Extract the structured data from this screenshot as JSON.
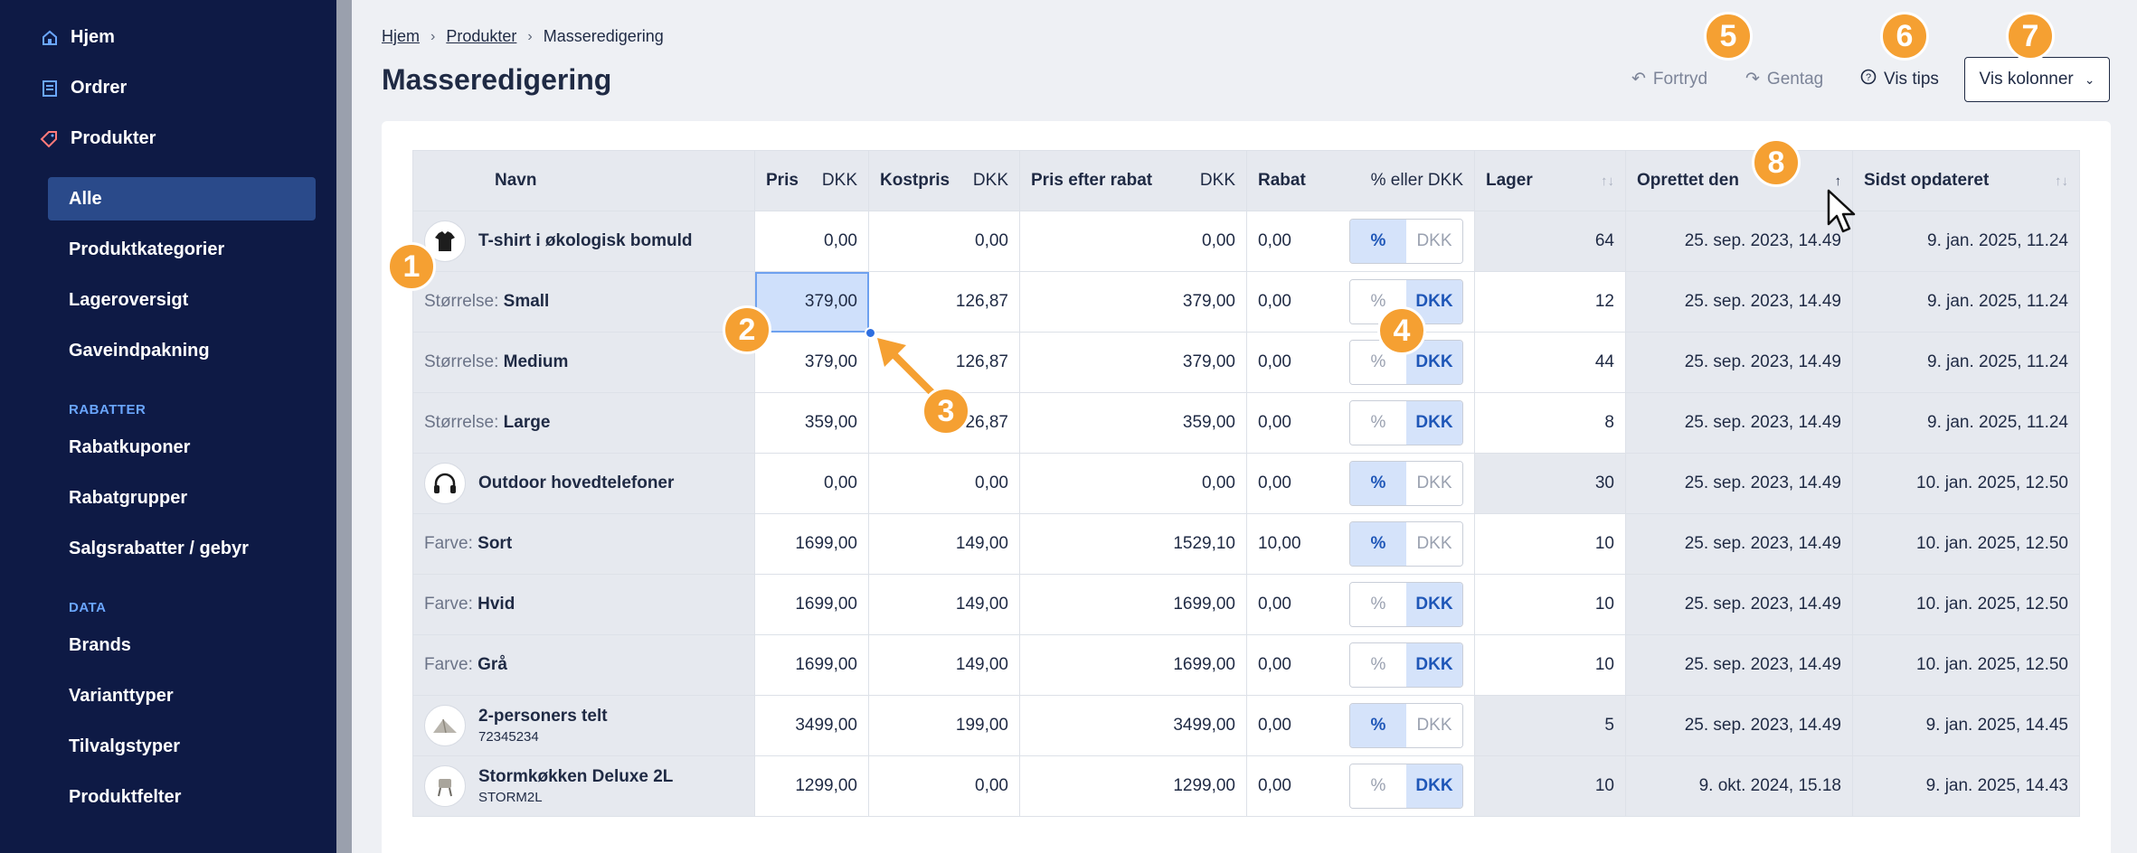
{
  "sidebar": {
    "top_items": [
      {
        "label": "Hjem",
        "icon": "home-icon"
      },
      {
        "label": "Ordrer",
        "icon": "orders-icon"
      },
      {
        "label": "Produkter",
        "icon": "tag-icon"
      }
    ],
    "product_items": [
      "Alle",
      "Produktkategorier",
      "Lageroversigt",
      "Gaveindpakning"
    ],
    "section_rabatter": "RABATTER",
    "rabatter_items": [
      "Rabatkuponer",
      "Rabatgrupper",
      "Salgsrabatter / gebyr"
    ],
    "section_data": "DATA",
    "data_items": [
      "Brands",
      "Varianttyper",
      "Tilvalgstyper",
      "Produktfelter"
    ]
  },
  "breadcrumb": [
    "Hjem",
    "Produkter",
    "Masseredigering"
  ],
  "page_title": "Masseredigering",
  "toolbar": {
    "undo": "Fortryd",
    "redo": "Gentag",
    "tips": "Vis tips",
    "columns": "Vis kolonner"
  },
  "table": {
    "headers": {
      "name": "Navn",
      "price": "Pris",
      "price_unit": "DKK",
      "cost": "Kostpris",
      "cost_unit": "DKK",
      "discounted": "Pris efter rabat",
      "discounted_unit": "DKK",
      "discount": "Rabat",
      "discount_unit": "% eller DKK",
      "stock": "Lager",
      "created": "Oprettet den",
      "updated": "Sidst opdateret"
    },
    "toggle_percent": "%",
    "toggle_dkk": "DKK",
    "rows": [
      {
        "kind": "product",
        "thumb": "tshirt-icon",
        "name": "T-shirt i økologisk bomuld",
        "sku": "",
        "price": "0,00",
        "cost": "0,00",
        "discounted": "0,00",
        "discount": "0,00",
        "mode": "percent",
        "stock": "64",
        "created": "25. sep. 2023, 14.49",
        "updated": "9. jan. 2025, 11.24"
      },
      {
        "kind": "variant",
        "vlabel": "Størrelse:",
        "vvalue": "Small",
        "price": "379,00",
        "cost": "126,87",
        "discounted": "379,00",
        "discount": "0,00",
        "mode": "dkk",
        "stock": "12",
        "created": "25. sep. 2023, 14.49",
        "updated": "9. jan. 2025, 11.24"
      },
      {
        "kind": "variant",
        "vlabel": "Størrelse:",
        "vvalue": "Medium",
        "price": "379,00",
        "cost": "126,87",
        "discounted": "379,00",
        "discount": "0,00",
        "mode": "dkk",
        "stock": "44",
        "created": "25. sep. 2023, 14.49",
        "updated": "9. jan. 2025, 11.24"
      },
      {
        "kind": "variant",
        "vlabel": "Størrelse:",
        "vvalue": "Large",
        "price": "359,00",
        "cost": "126,87",
        "discounted": "359,00",
        "discount": "0,00",
        "mode": "dkk",
        "stock": "8",
        "created": "25. sep. 2023, 14.49",
        "updated": "9. jan. 2025, 11.24"
      },
      {
        "kind": "product",
        "thumb": "headphones-icon",
        "name": "Outdoor hovedtelefoner",
        "sku": "",
        "price": "0,00",
        "cost": "0,00",
        "discounted": "0,00",
        "discount": "0,00",
        "mode": "percent",
        "stock": "30",
        "created": "25. sep. 2023, 14.49",
        "updated": "10. jan. 2025, 12.50"
      },
      {
        "kind": "variant",
        "vlabel": "Farve:",
        "vvalue": "Sort",
        "price": "1699,00",
        "cost": "149,00",
        "discounted": "1529,10",
        "discount": "10,00",
        "mode": "percent",
        "stock": "10",
        "created": "25. sep. 2023, 14.49",
        "updated": "10. jan. 2025, 12.50"
      },
      {
        "kind": "variant",
        "vlabel": "Farve:",
        "vvalue": "Hvid",
        "price": "1699,00",
        "cost": "149,00",
        "discounted": "1699,00",
        "discount": "0,00",
        "mode": "dkk",
        "stock": "10",
        "created": "25. sep. 2023, 14.49",
        "updated": "10. jan. 2025, 12.50"
      },
      {
        "kind": "variant",
        "vlabel": "Farve:",
        "vvalue": "Grå",
        "price": "1699,00",
        "cost": "149,00",
        "discounted": "1699,00",
        "discount": "0,00",
        "mode": "dkk",
        "stock": "10",
        "created": "25. sep. 2023, 14.49",
        "updated": "10. jan. 2025, 12.50"
      },
      {
        "kind": "product",
        "thumb": "tent-icon",
        "name": "2-personers telt",
        "sku": "72345234",
        "price": "3499,00",
        "cost": "199,00",
        "discounted": "3499,00",
        "discount": "0,00",
        "mode": "percent",
        "stock": "5",
        "created": "25. sep. 2023, 14.49",
        "updated": "9. jan. 2025, 14.45"
      },
      {
        "kind": "product",
        "thumb": "stove-icon",
        "name": "Stormkøkken Deluxe 2L",
        "sku": "STORM2L",
        "price": "1299,00",
        "cost": "0,00",
        "discounted": "1299,00",
        "discount": "0,00",
        "mode": "dkk",
        "stock": "10",
        "created": "9. okt. 2024, 15.18",
        "updated": "9. jan. 2025, 14.43"
      }
    ]
  },
  "callouts": [
    "1",
    "2",
    "3",
    "4",
    "5",
    "6",
    "7",
    "8"
  ],
  "colors": {
    "sidebar": "#0e1a45",
    "accent": "#f5a032",
    "selection": "#cfe0fb",
    "toggle_on": "#d5e3fa"
  }
}
